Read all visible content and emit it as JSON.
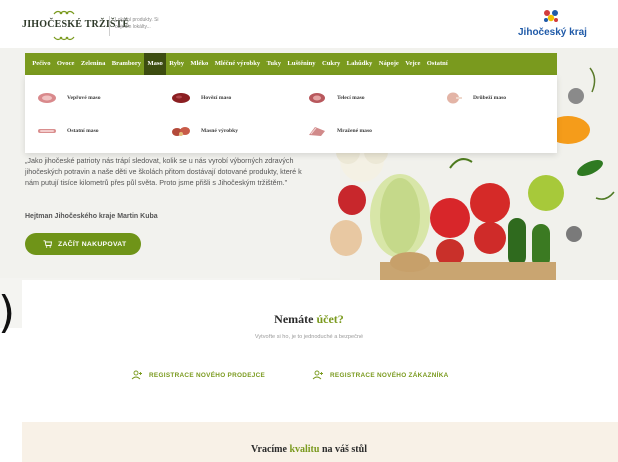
{
  "header": {
    "logo_name": "JIHOČESKÉ TRŽIŠTĚ",
    "logo_tagline": "Lokální produkty. Si objedín lokálty...",
    "region_name": "Jihočeský kraj"
  },
  "nav": {
    "items": [
      "Pečivo",
      "Ovoce",
      "Zelenina",
      "Brambory",
      "Maso",
      "Ryby",
      "Mléko",
      "Mléčné výrobky",
      "Tuky",
      "Luštěniny",
      "Cukry",
      "Lahůdky",
      "Nápoje",
      "Vejce",
      "Ostatní"
    ],
    "active": "Maso"
  },
  "dropdown": {
    "items": [
      {
        "label": "Vepřové maso",
        "icon": "pork-meat-icon"
      },
      {
        "label": "Hovězí maso",
        "icon": "beef-meat-icon"
      },
      {
        "label": "Telecí maso",
        "icon": "veal-meat-icon"
      },
      {
        "label": "Drůbeží maso",
        "icon": "poultry-meat-icon"
      },
      {
        "label": "Ostatní maso",
        "icon": "other-meat-icon"
      },
      {
        "label": "Masné výrobky",
        "icon": "meat-products-icon"
      },
      {
        "label": "Mražené maso",
        "icon": "frozen-meat-icon"
      }
    ]
  },
  "hero": {
    "quote": "„Jako jihočeské patrioty nás trápí sledovat, kolik se u nás vyrobí výborných zdravých jihočeských potravin a naše děti ve školách přitom dostávají dotované produkty, které k nám putují tisíce kilometrů přes půl světa. Proto jsme přišli s Jihočeským tržištěm.\"",
    "author": "Hejtman Jihočeského kraje Martin Kuba",
    "cta_label": "ZAČÍT NAKUPOVAT"
  },
  "stray_glyph": ")",
  "account": {
    "title_prefix": "Nemáte",
    "title_highlight": "účet?",
    "subtitle": "Vytvořte si ho, je to jednoduché a bezpečné",
    "register_seller": "REGISTRACE NOVÉHO PRODEJCE",
    "register_customer": "REGISTRACE NOVÉHO ZÁKAZNÍKA"
  },
  "band": {
    "title_prefix": "Vracíme",
    "title_highlight": "kvalitu",
    "title_suffix": "na váš stůl"
  },
  "colors": {
    "brand_green": "#7a9a1e",
    "nav_active": "#3d4d10",
    "region_blue": "#1f5aa8",
    "band_bg": "#f8f1e7"
  }
}
